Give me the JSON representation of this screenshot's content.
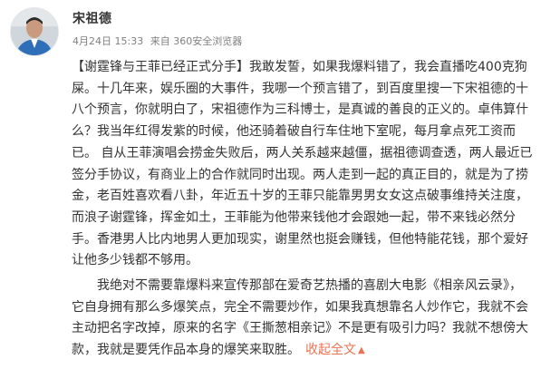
{
  "author": {
    "name": "宋祖德",
    "avatar_icon": "user-avatar-photo"
  },
  "meta": {
    "date": "4月24日 15:33",
    "from_label": "来自",
    "client": "360安全浏览器"
  },
  "post": {
    "topic": "【谢霆锋与王菲已经正式分手】",
    "paragraph1": "我敢发誓，如果我爆料错了，我会直播吃400克狗屎。十几年来，娱乐圈的大事件，我哪一个预言错了，到百度里搜一下宋祖德的十八个预言，你就明白了，宋祖德作为三科博士，是真诚的善良的正义的。卓伟算什么？我当年红得发紫的时候，他还骑着破自行车住地下室呢，每月拿点死工资而已。 自从王菲演唱会捞金失败后，两人关系越来越僵，据祖德调查透，两人最近已签分手协议，有商业上的合作就同时出现。两人走到一起的真正目的，就是为了捞金，老百姓喜欢看八卦，年近五十岁的王菲只能靠男男女女这点破事维持关注度，而浪子谢霆锋，挥金如土，王菲能为他带来钱他才会跟她一起，带不来钱必然分手。香港男人比内地男人更加现实，谢里然也挺会赚钱，但他特能花钱，那个爱好让他多少钱都不够用。",
    "paragraph2": "我绝对不需要靠爆料来宣传那部在爱奇艺热播的喜剧大电影《相亲风云录》，它自身拥有那么多爆笑点，完全不需要炒作，如果我真想靠名人炒作它，我就不会主动把名字改掉，原来的名字《王撕葱相亲记》不是更有吸引力吗？我就不想傍大款，我就是要凭作品本身的爆笑来取胜。",
    "collapse_label": "收起全文",
    "collapse_icon": "chevron-up-icon"
  },
  "colors": {
    "text": "#333333",
    "meta": "#808080",
    "link_accent": "#eb7350"
  }
}
